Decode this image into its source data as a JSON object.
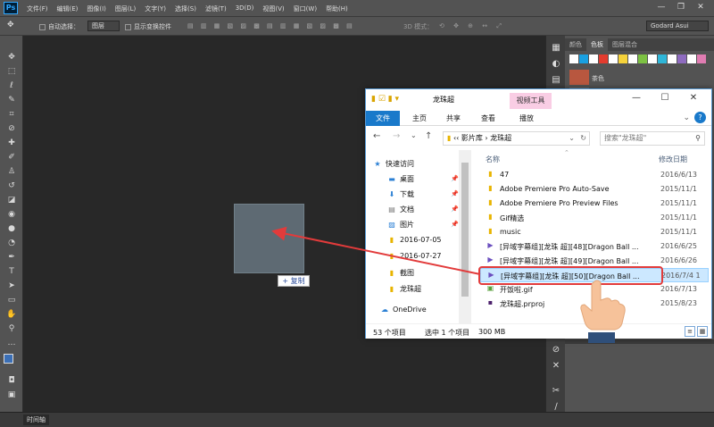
{
  "photoshop": {
    "logo": "Ps",
    "menu": [
      "文件(F)",
      "编辑(E)",
      "图像(I)",
      "图层(L)",
      "文字(Y)",
      "选择(S)",
      "滤镜(T)",
      "3D(D)",
      "视图(V)",
      "窗口(W)",
      "帮助(H)"
    ],
    "window_controls": [
      "—",
      "❐",
      "✕"
    ],
    "options": {
      "auto_select_label": "自动选择：",
      "auto_select_value": "图层",
      "show_transform_label": "显示变换控件",
      "mode_label": "3D 模式：",
      "workspace": "Godard Asui"
    },
    "panel_tabs": [
      "颜色",
      "色板",
      "图层混合"
    ],
    "swatch_label": "茶色",
    "swatch_color": "#b8573f",
    "timeline_tab": "时间轴",
    "copy_tooltip": "+ 复制"
  },
  "explorer": {
    "title": "龙珠超",
    "contextual_tab": "视频工具",
    "ribbon_tabs": {
      "file": "文件",
      "home": "主页",
      "share": "共享",
      "view": "查看",
      "play": "播放"
    },
    "path": {
      "root": "影片库",
      "folder": "龙珠超"
    },
    "search_placeholder": "搜索\"龙珠超\"",
    "nav": {
      "quick_access": "快速访问",
      "desktop": "桌面",
      "downloads": "下载",
      "documents": "文档",
      "pictures": "图片",
      "folder1": "2016-07-05",
      "folder2": "2016-07-27",
      "screenshots": "截图",
      "dragonball": "龙珠超",
      "onedrive": "OneDrive"
    },
    "columns": {
      "name": "名称",
      "date": "修改日期"
    },
    "files": [
      {
        "name": "47",
        "date": "2016/6/13"
      },
      {
        "name": "Adobe Premiere Pro Auto-Save",
        "date": "2015/11/1"
      },
      {
        "name": "Adobe Premiere Pro Preview Files",
        "date": "2015/11/1"
      },
      {
        "name": "Gif精选",
        "date": "2015/11/1"
      },
      {
        "name": "music",
        "date": "2015/11/1"
      },
      {
        "name": "[异域字幕组][龙珠 超][48][Dragon Ball ...",
        "date": "2016/6/25"
      },
      {
        "name": "[异域字幕组][龙珠 超][49][Dragon Ball ...",
        "date": "2016/6/26"
      },
      {
        "name": "[异域字幕组][龙珠 超][50][Dragon Ball ...",
        "date": "2016/7/4 1"
      },
      {
        "name": "开饭啦.gif",
        "date": "2016/7/13"
      },
      {
        "name": "龙珠超.prproj",
        "date": "2015/8/23"
      }
    ],
    "status": {
      "count": "53 个项目",
      "selected": "选中 1 个项目",
      "size": "300 MB"
    }
  }
}
